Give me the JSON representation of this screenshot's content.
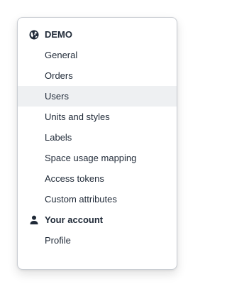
{
  "nav": {
    "sections": [
      {
        "title": "DEMO",
        "icon": "globe-icon",
        "items": [
          {
            "label": "General"
          },
          {
            "label": "Orders"
          },
          {
            "label": "Users",
            "active": true
          },
          {
            "label": "Units and styles"
          },
          {
            "label": "Labels"
          },
          {
            "label": "Space usage mapping"
          },
          {
            "label": "Access tokens"
          },
          {
            "label": "Custom attributes"
          }
        ]
      },
      {
        "title": "Your account",
        "icon": "user-icon",
        "items": [
          {
            "label": "Profile"
          }
        ]
      }
    ]
  },
  "colors": {
    "active_background": "#eef0f2",
    "text": "#1f2937",
    "border": "#c9cdd3"
  }
}
